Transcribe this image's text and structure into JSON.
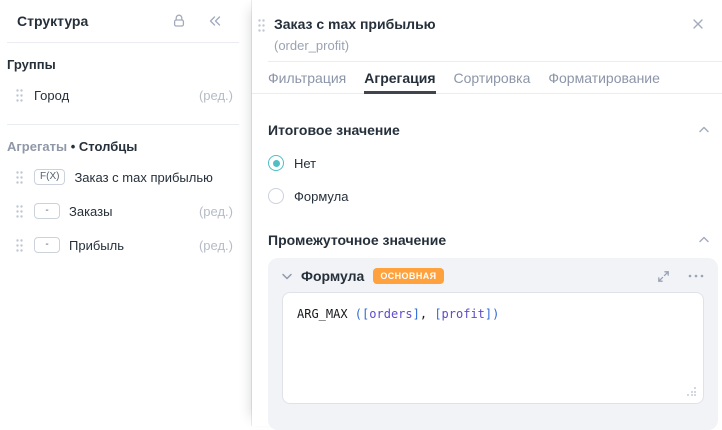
{
  "colors": {
    "accent_teal": "#4dbfc5",
    "badge_orange": "#ffa13c",
    "active_tab_underline": "#3f444d",
    "text_dark": "#26303b",
    "text_muted": "#8c95a8",
    "card_background": "#f1f3f6"
  },
  "sidebar": {
    "title": "Структура",
    "icons": [
      "lock-icon",
      "collapse-double-chevron-left-icon"
    ],
    "groups_section": {
      "title": "Группы",
      "items": [
        {
          "label": "Город",
          "edit": "(ред.)"
        }
      ]
    },
    "aggregates_section": {
      "title_muted": "Агрегаты",
      "separator": "•",
      "title_strong": "Столбцы",
      "items": [
        {
          "badge": "F(X)",
          "label": "Заказ с max прибылью",
          "edit": ""
        },
        {
          "badge": "-",
          "label": "Заказы",
          "edit": "(ред.)"
        },
        {
          "badge": "-",
          "label": "Прибыль",
          "edit": "(ред.)"
        }
      ]
    }
  },
  "panel": {
    "title": "Заказ с max прибылью",
    "subtitle": "(order_profit)",
    "tabs": [
      {
        "label": "Фильтрация",
        "active": false
      },
      {
        "label": "Агрегация",
        "active": true
      },
      {
        "label": "Сортировка",
        "active": false
      },
      {
        "label": "Форматирование",
        "active": false
      }
    ],
    "total_section": {
      "title": "Итоговое значение",
      "options": [
        {
          "label": "Нет",
          "selected": true
        },
        {
          "label": "Формула",
          "selected": false
        }
      ]
    },
    "intermediate_section": {
      "title": "Промежуточное значение",
      "formula_block": {
        "title": "Формула",
        "badge": "ОСНОВНАЯ",
        "code_full": "ARG_MAX ([orders], [profit])",
        "code_tokens": [
          {
            "text": "ARG_MAX ",
            "type": "function"
          },
          {
            "text": "(",
            "type": "paren"
          },
          {
            "text": "[",
            "type": "bracket"
          },
          {
            "text": "orders",
            "type": "field"
          },
          {
            "text": "]",
            "type": "bracket"
          },
          {
            "text": ", ",
            "type": "plain"
          },
          {
            "text": "[",
            "type": "bracket"
          },
          {
            "text": "profit",
            "type": "field"
          },
          {
            "text": "]",
            "type": "bracket"
          },
          {
            "text": ")",
            "type": "paren"
          }
        ]
      }
    }
  }
}
